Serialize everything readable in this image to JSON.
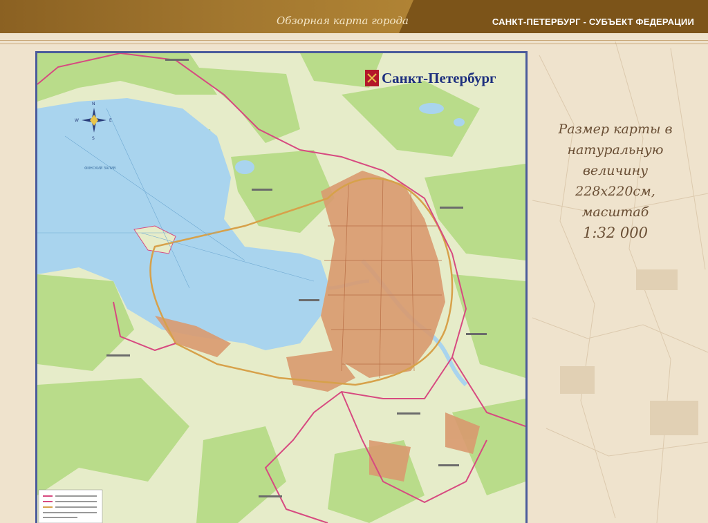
{
  "header": {
    "left_title": "Обзорная карта города",
    "right_title": "САНКТ-ПЕТЕРБУРГ - СУБЪЕКТ ФЕДЕРАЦИИ"
  },
  "map": {
    "city_title": "Санкт-Петербург",
    "gulf_label": "ФИНСКИЙ ЗАЛИВ",
    "compass_n": "N",
    "compass_s": "S",
    "compass_w": "W",
    "compass_e": "E"
  },
  "description": {
    "line1": "Размер карты в",
    "line2": "натуральную",
    "line3": "величину",
    "line4": "228х220см,",
    "line5": "масштаб",
    "line6": "1:32 000"
  },
  "colors": {
    "header_bg": "#7c5419",
    "water": "#a9d4ee",
    "forest": "#b9dc8a",
    "land": "#e6ecc9",
    "city": "#d99a6f",
    "border_pink": "#d74a80",
    "ring_road": "#d7a14a"
  }
}
